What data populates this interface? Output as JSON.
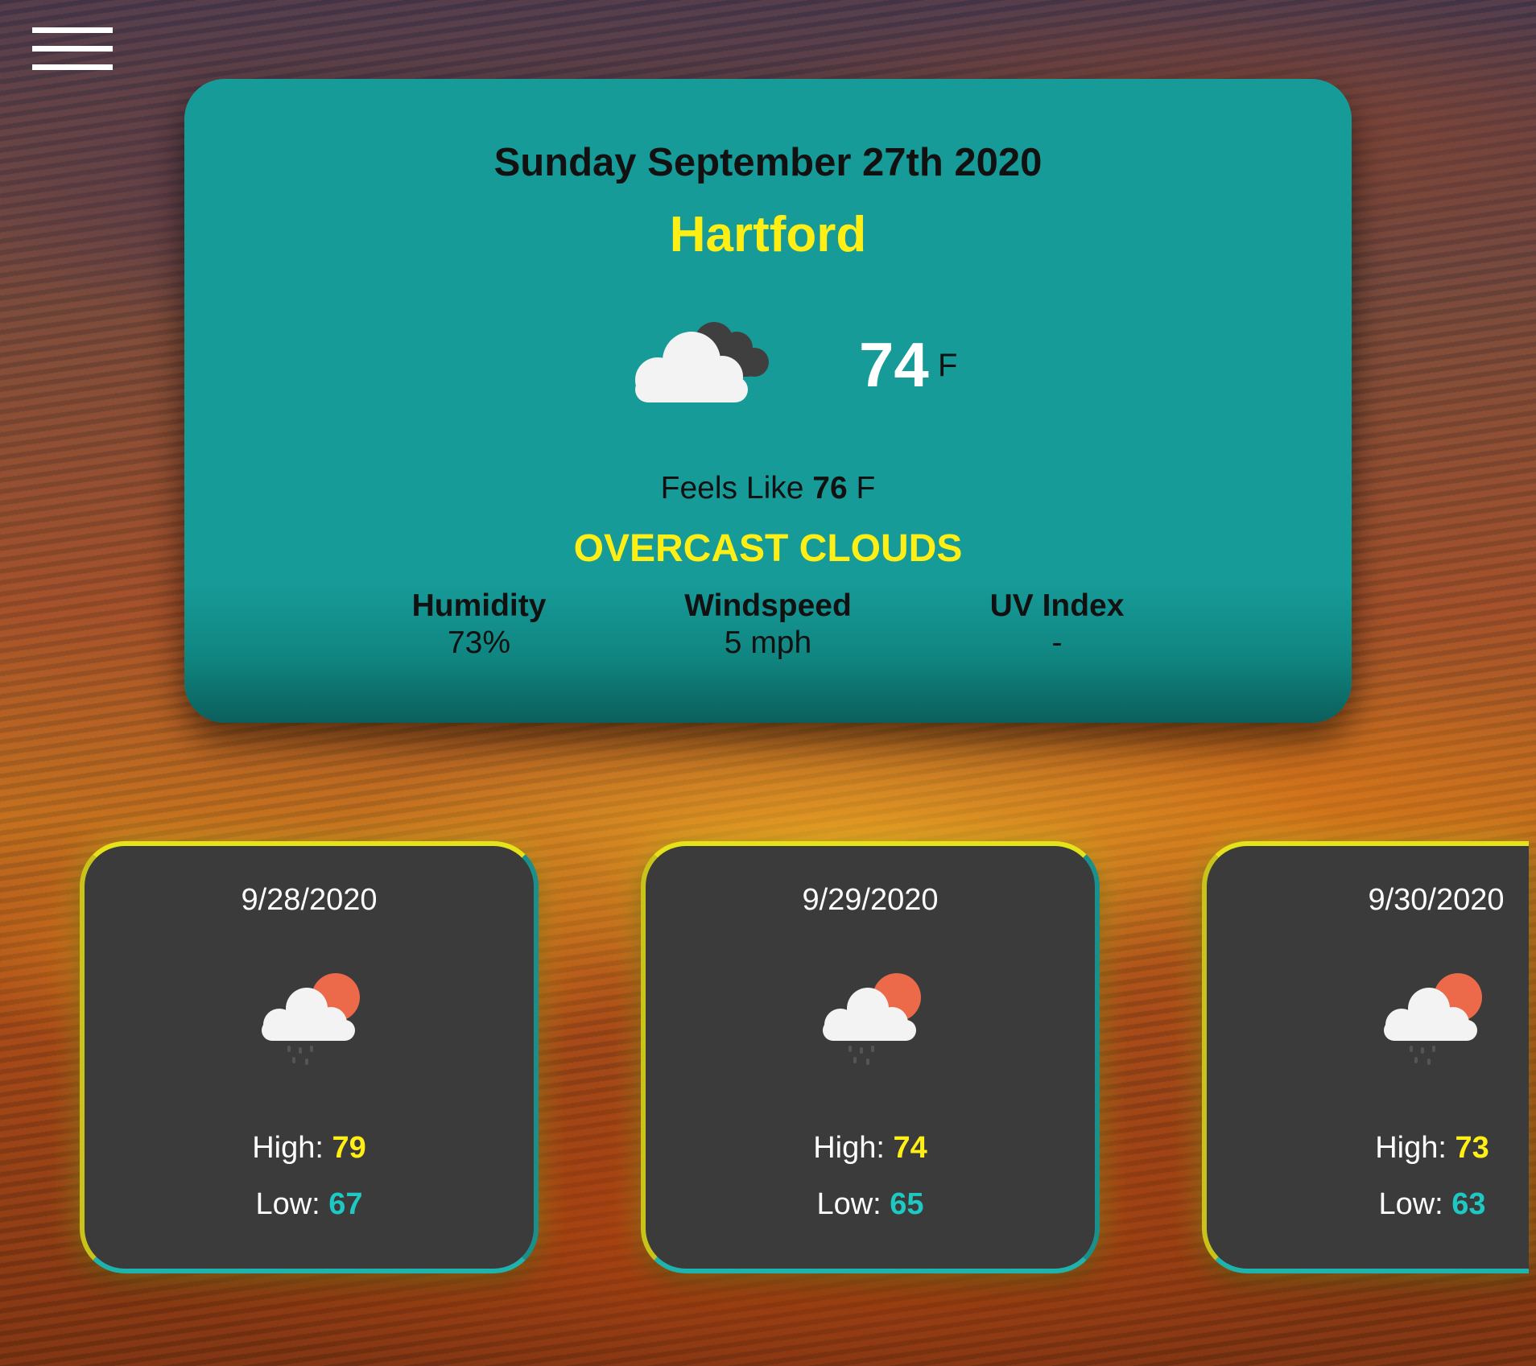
{
  "nav": {
    "menu_icon": "hamburger-menu-icon"
  },
  "current": {
    "date": "Sunday September 27th 2020",
    "city": "Hartford",
    "icon": "overcast-clouds-icon",
    "temperature": "74",
    "temperature_unit": "F",
    "feels_like_label": "Feels Like",
    "feels_like_value": "76",
    "feels_like_unit": "F",
    "condition": "OVERCAST CLOUDS",
    "stats": [
      {
        "label": "Humidity",
        "value": "73%"
      },
      {
        "label": "Windspeed",
        "value": "5 mph"
      },
      {
        "label": "UV Index",
        "value": "-"
      }
    ]
  },
  "forecast": [
    {
      "date": "9/28/2020",
      "icon": "light-rain-sun-icon",
      "high_label": "High:",
      "high": "79",
      "low_label": "Low:",
      "low": "67"
    },
    {
      "date": "9/29/2020",
      "icon": "light-rain-sun-icon",
      "high_label": "High:",
      "high": "74",
      "low_label": "Low:",
      "low": "65"
    },
    {
      "date": "9/30/2020",
      "icon": "light-rain-sun-icon",
      "high_label": "High:",
      "high": "73",
      "low_label": "Low:",
      "low": "63"
    }
  ],
  "colors": {
    "card_teal": "#179b99",
    "accent_yellow": "#ffef14",
    "low_teal": "#1ec8c3",
    "forecast_card": "#3b3b3b"
  }
}
